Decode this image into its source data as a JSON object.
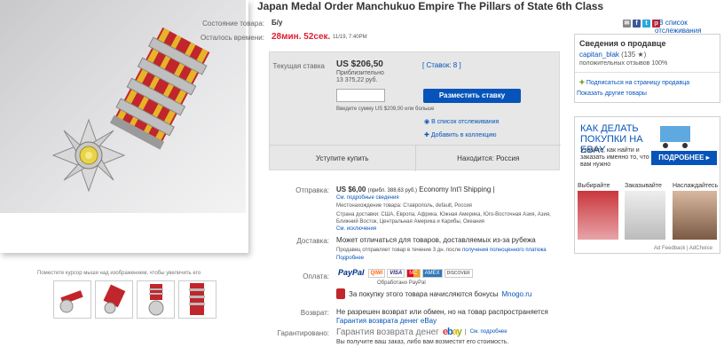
{
  "title": "Japan Medal Order Manchukuo Empire The Pillars of State 6th Class",
  "share": {
    "watch_label": "| В список отслеживания"
  },
  "item": {
    "condition_label": "Состояние товара:",
    "condition_value": "Б/у",
    "time_label": "Осталось времени:",
    "time_value": "28мин. 52сек.",
    "time_end": "11/19, 7:40PM"
  },
  "bid": {
    "current_label": "Текущая ставка",
    "price": "US $206,50",
    "approx_label": "Приблизительно",
    "approx_value": "13 375,22 руб.",
    "bids_link": "[ Ставок: 8 ]",
    "place_button": "Разместить ставку",
    "hint": "Введите сумму US $209,00 или больше",
    "watch_link": "В список отслеживания",
    "collection_link": "Добавить в коллекцию",
    "buy_label": "Уступите купить",
    "location_label": "Находится: Россия"
  },
  "seller": {
    "header": "Сведения о продавце",
    "name": "capitan_blak",
    "score": "(135 ★)",
    "positive": "положительных отзывов 100%",
    "subscribe": "Подписаться на страницу продавца",
    "other_items": "Показать другие товары"
  },
  "ad": {
    "headline": "КАК ДЕЛАТЬ ПОКУПКИ НА EBAY",
    "sub": "Узнайте, как найти и заказать именно то, что вам нужно",
    "button": "ПОДРОБНЕЕ",
    "tiles": [
      "Выбирайте",
      "Заказывайте",
      "Наслаждайтесь"
    ],
    "feedback": "Ad Feedback | AdChoice"
  },
  "shipping": {
    "label": "Отправка:",
    "price": "US $6,00",
    "approx": "(прибл. 388,63 руб.)",
    "service": "Economy Int'l Shipping |",
    "details_link": "См. подробные сведения",
    "location_line": "Местонахождение товара: Ставрополь, default, Россия",
    "destinations": "Страна доставки: США, Европа, Африка, Южная Америка, Юго-Восточная Азия, Азия, Ближний Восток, Центральная Америка и Карибы, Океания",
    "exceptions_link": "См. исключения"
  },
  "delivery": {
    "label": "Доставка:",
    "text": "Может отличаться для товаров, доставляемых из-за рубежа",
    "note": "Продавец отправляет товар в течение 3 дн. после",
    "note_link": "получения полноценного платежа",
    "more_link": "Подробнее"
  },
  "payments": {
    "label": "Оплата:",
    "logos": [
      "PayPal",
      "QIWI",
      "VISA",
      "MC",
      "AMEX",
      "DISCOVER"
    ],
    "processed": "Обработано PayPal",
    "bonus": "За покупку этого товара начисляются бонусы",
    "bonus_link": "Mnogo.ru"
  },
  "returns": {
    "label": "Возврат:",
    "text": "Не разрешен возврат или обмен, но на товар распространяется",
    "link": "Гарантия возврата денег eBay"
  },
  "guarantee": {
    "label": "Гарантировано:",
    "text": "Гарантия возврата денег",
    "link": "См. подробнее",
    "note": "Вы получите ваш заказ, либо вам возместят его стоимость."
  },
  "gallery": {
    "hint": "Поместите курсор мыши над изображением, чтобы увеличить его"
  },
  "colors": {
    "link": "#0654ba",
    "price_red": "#dd1e31",
    "ribbon_red": "#c0262b",
    "ribbon_yellow": "#e6b42a"
  }
}
